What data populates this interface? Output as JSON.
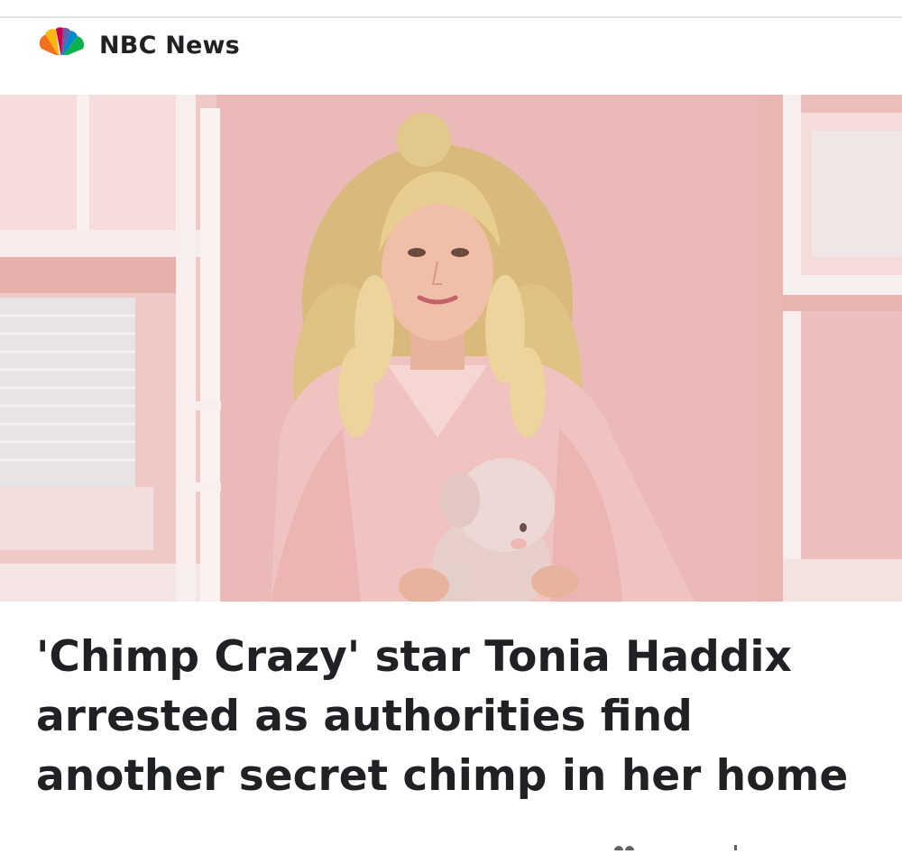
{
  "source": {
    "name": "NBC News",
    "logo_icon": "nbc-peacock-icon",
    "logo_colors": [
      "#fcb711",
      "#f37021",
      "#cc004c",
      "#6460aa",
      "#0089d0",
      "#0db14b"
    ]
  },
  "article": {
    "headline": "'Chimp Crazy' star Tonia Haddix arrested as authorities find another secret chimp in her home"
  },
  "hero": {
    "description_icon": "photo-woman-with-plush-toy",
    "colors": {
      "wall": "#e9b6b4",
      "bed_frame": "#f3e4e2",
      "hair": "#e3c88c",
      "robe": "#f1c3c0"
    }
  }
}
